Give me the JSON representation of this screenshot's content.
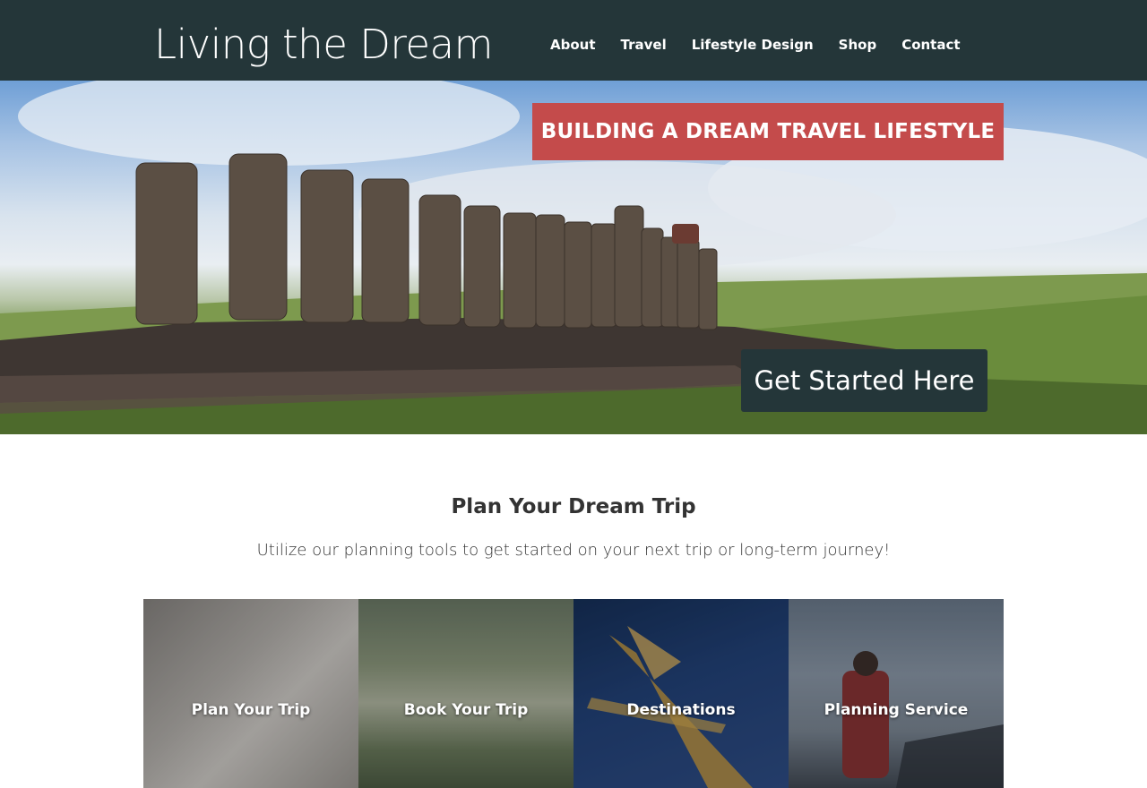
{
  "header": {
    "logo_text": "Living the Dream",
    "nav": [
      {
        "label": "About"
      },
      {
        "label": "Travel"
      },
      {
        "label": "Lifestyle Design"
      },
      {
        "label": "Shop"
      },
      {
        "label": "Contact"
      }
    ]
  },
  "hero": {
    "banner_text": "BUILDING A DREAM TRAVEL LIFESTYLE",
    "cta_label": "Get Started Here"
  },
  "plan": {
    "title": "Plan Your Dream Trip",
    "subtitle": "Utilize our planning tools to get started on your next trip or long-term journey!",
    "cards": [
      {
        "label": "Plan Your Trip"
      },
      {
        "label": "Book Your Trip"
      },
      {
        "label": "Destinations"
      },
      {
        "label": "Planning Service"
      }
    ]
  },
  "colors": {
    "header_bg": "#243639",
    "banner_bg": "#c44b4b",
    "cta_bg": "#243639"
  }
}
